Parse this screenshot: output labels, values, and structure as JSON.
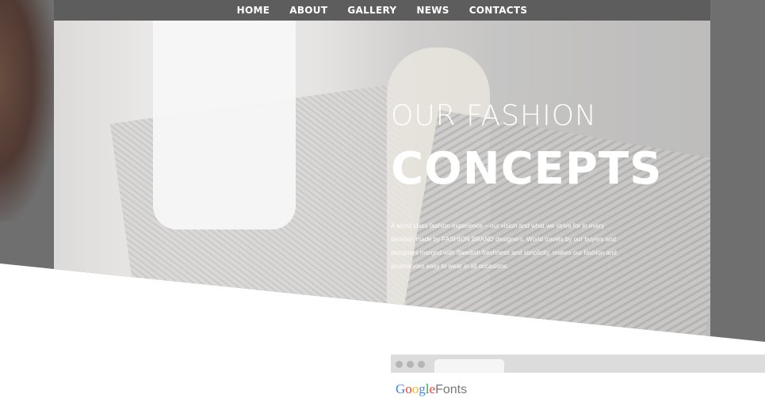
{
  "nav": {
    "items": [
      "HOME",
      "ABOUT",
      "GALLERY",
      "NEWS",
      "CONTACTS"
    ]
  },
  "hero": {
    "line1": "OUR FASHION",
    "line2": "CONCEPTS",
    "description": "A world class fashion experience – our vision and what we strive for in every decision made by FASHION BRAND designers. World travels by our buyers and designers merged with Swedish freshness and simplicity, makes our fashion and accessories easy to wear in all occasions."
  },
  "browser": {
    "logo_letters": [
      {
        "ch": "G",
        "color": "#4285F4"
      },
      {
        "ch": "o",
        "color": "#EA4335"
      },
      {
        "ch": "o",
        "color": "#FBBC05"
      },
      {
        "ch": "g",
        "color": "#4285F4"
      },
      {
        "ch": "l",
        "color": "#34A853"
      },
      {
        "ch": "e",
        "color": "#EA4335"
      }
    ],
    "logo_suffix": "Fonts"
  }
}
